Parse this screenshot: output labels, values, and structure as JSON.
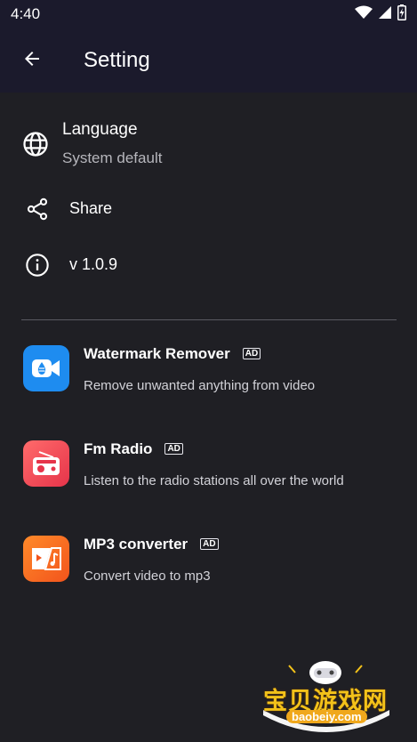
{
  "status_bar": {
    "time": "4:40",
    "icons": [
      "wifi-icon",
      "signal-icon",
      "battery-charging-icon"
    ]
  },
  "app_bar": {
    "back_icon": "arrow-left-icon",
    "title": "Setting"
  },
  "settings": {
    "language": {
      "title": "Language",
      "value": "System default",
      "icon": "globe-icon"
    },
    "share": {
      "title": "Share",
      "icon": "share-icon"
    },
    "version": {
      "title": "v 1.0.9",
      "icon": "info-icon"
    }
  },
  "promos": [
    {
      "title": "Watermark Remover",
      "badge": "AD",
      "description": "Remove unwanted anything from video",
      "icon": "watermark-remover-app-icon",
      "color": "#1e8cf0"
    },
    {
      "title": "Fm Radio",
      "badge": "AD",
      "description": "Listen to the radio stations all over the world",
      "icon": "radio-app-icon",
      "color": "#ee4452"
    },
    {
      "title": "MP3 converter",
      "badge": "AD",
      "description": "Convert video to mp3",
      "icon": "mp3-converter-app-icon",
      "color": "#f56a22"
    }
  ],
  "watermark": {
    "brand": "宝贝游戏网",
    "url": "baobeiy.com"
  },
  "colors": {
    "background": "#1f1f24",
    "app_bar": "#1b1a2c",
    "divider": "#5a5a61"
  }
}
